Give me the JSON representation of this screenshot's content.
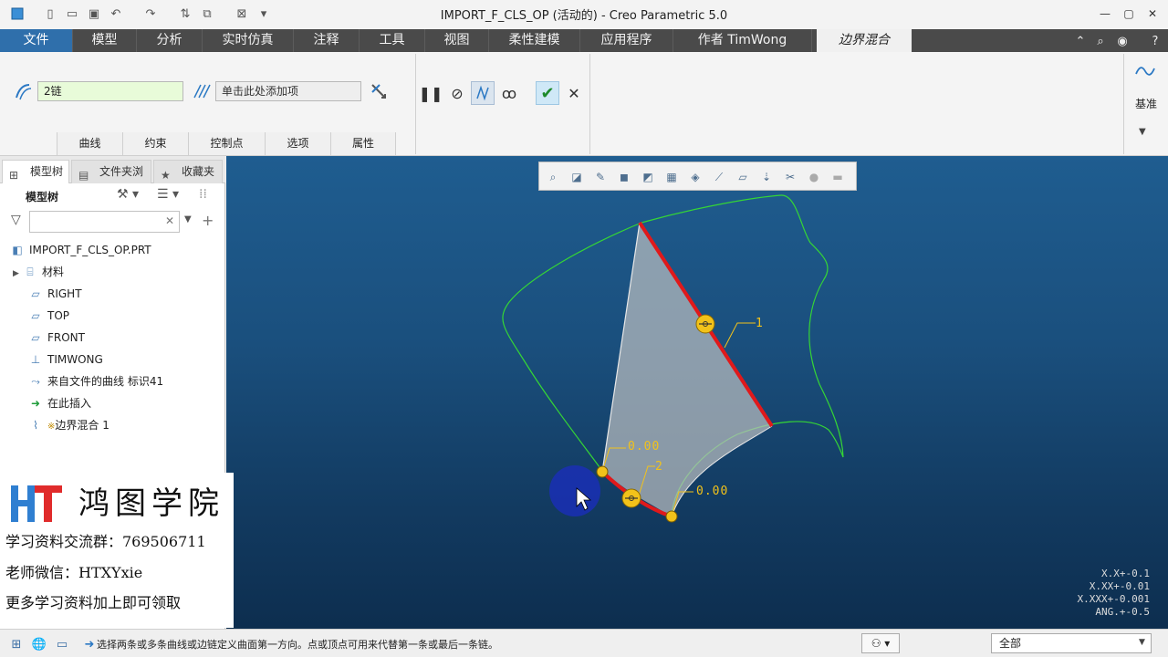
{
  "window": {
    "title": "IMPORT_F_CLS_OP (活动的) - Creo Parametric 5.0"
  },
  "tabs": [
    {
      "label": "文件"
    },
    {
      "label": "模型"
    },
    {
      "label": "分析"
    },
    {
      "label": "实时仿真"
    },
    {
      "label": "注释"
    },
    {
      "label": "工具"
    },
    {
      "label": "视图"
    },
    {
      "label": "柔性建模"
    },
    {
      "label": "应用程序"
    },
    {
      "label": "作者 TimWong"
    },
    {
      "label": "边界混合"
    }
  ],
  "ribbon": {
    "first_direction_value": "2链",
    "second_direction_placeholder": "单击此处添加项",
    "subtabs": [
      {
        "label": "曲线"
      },
      {
        "label": "约束"
      },
      {
        "label": "控制点"
      },
      {
        "label": "选项"
      },
      {
        "label": "属性"
      }
    ],
    "datum_label": "基准"
  },
  "left_panel": {
    "tabs": [
      {
        "label": "模型树"
      },
      {
        "label": "文件夹浏"
      },
      {
        "label": "收藏夹"
      }
    ],
    "tree_header": "模型树",
    "tree_items": [
      {
        "label": "IMPORT_F_CLS_OP.PRT"
      },
      {
        "label": "材料"
      },
      {
        "label": "RIGHT"
      },
      {
        "label": "TOP"
      },
      {
        "label": "FRONT"
      },
      {
        "label": "TIMWONG"
      },
      {
        "label": "来自文件的曲线 标识41"
      },
      {
        "label": "在此插入"
      },
      {
        "label": "边界混合 1"
      }
    ],
    "new_marker": "※"
  },
  "watermark": {
    "logo_text": "鸿图学院",
    "line1": "学习资料交流群：769506711",
    "line2": "老师微信：HTXYxie",
    "line3": "更多学习资料加上即可领取"
  },
  "viewport": {
    "labels": {
      "chain1": "1",
      "chain2": "2",
      "value_a": "0.00",
      "value_b": "0.00"
    },
    "tolerances": [
      "X.X+-0.1",
      "X.XX+-0.01",
      "X.XXX+-0.001",
      "ANG.+-0.5"
    ],
    "colors": {
      "selected_chain": "#e0191b",
      "curve": "#35d635",
      "handle": "#f2c21a",
      "surface": "#b8bcbf"
    }
  },
  "status": {
    "message": "选择两条或多条曲线或边链定义曲面第一方向。点或顶点可用来代替第一条或最后一条链。",
    "filter_value": "全部"
  }
}
